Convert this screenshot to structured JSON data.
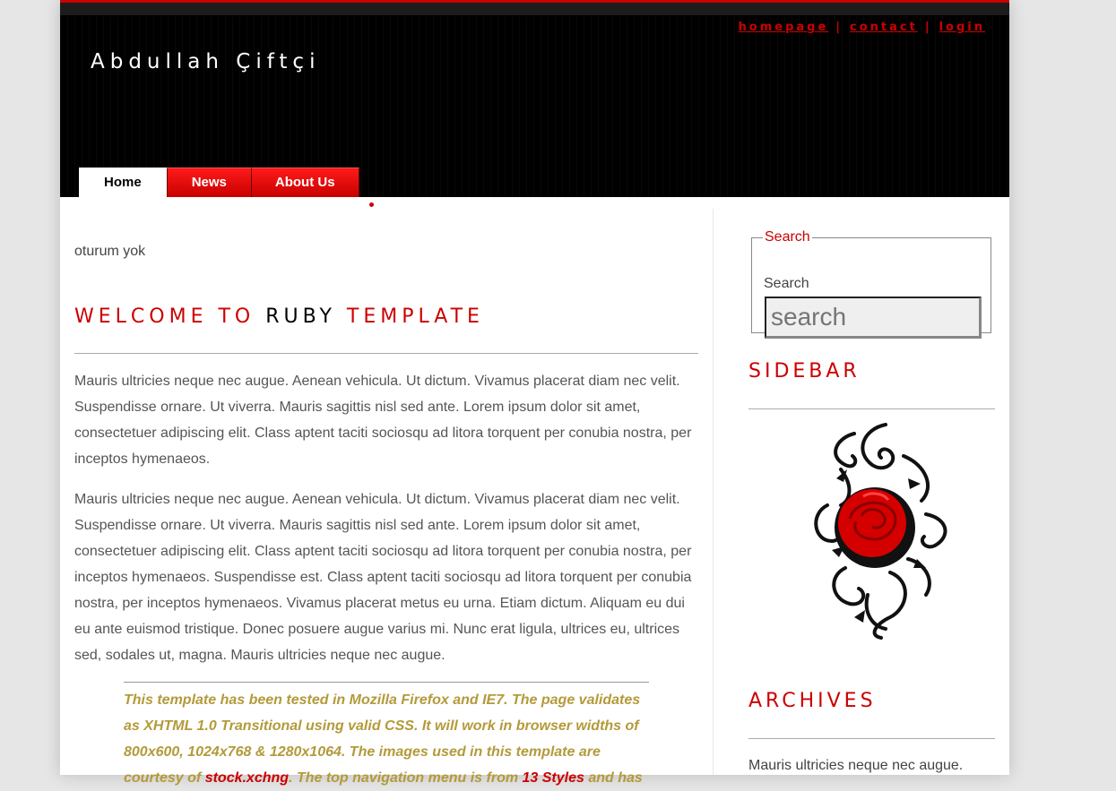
{
  "header": {
    "site_title": "Abdullah Çiftçi",
    "links": {
      "homepage": "homepage",
      "contact": "contact",
      "login": "login",
      "separator": "|"
    }
  },
  "nav": {
    "tabs": [
      {
        "label": "Home"
      },
      {
        "label": "News"
      },
      {
        "label": "About Us"
      }
    ]
  },
  "main": {
    "status": "oturum yok",
    "heading": {
      "part1": "WELCOME TO ",
      "part2": "RUBY",
      "part3": " TEMPLATE"
    },
    "paragraph1": "Mauris ultricies neque nec augue. Aenean vehicula. Ut dictum. Vivamus placerat diam nec velit. Suspendisse ornare. Ut viverra. Mauris sagittis nisl sed ante. Lorem ipsum dolor sit amet, consectetuer adipiscing elit. Class aptent taciti sociosqu ad litora torquent per conubia nostra, per inceptos hymenaeos.",
    "paragraph2": "Mauris ultricies neque nec augue. Aenean vehicula. Ut dictum. Vivamus placerat diam nec velit. Suspendisse ornare. Ut viverra. Mauris sagittis nisl sed ante. Lorem ipsum dolor sit amet, consectetuer adipiscing elit. Class aptent taciti sociosqu ad litora torquent per conubia nostra, per inceptos hymenaeos. Suspendisse est. Class aptent taciti sociosqu ad litora torquent per conubia nostra, per inceptos hymenaeos. Vivamus placerat metus eu urna. Etiam dictum. Aliquam eu dui eu ante euismod tristique. Donec posuere augue varius mi. Nunc erat ligula, ultrices eu, ultrices sed, sodales ut, magna. Mauris ultricies neque nec augue.",
    "quote": {
      "text1": "This template has been tested in Mozilla Firefox and IE7. The page validates as XHTML 1.0 Transitional using valid CSS. It will work in browser widths of 800x600, 1024x768 & 1280x1064. The images used in this template are courtesy of ",
      "link1": "stock.xchng",
      "text2": ". The top navigation menu is from ",
      "link2": "13 Styles",
      "text3": " and has"
    }
  },
  "sidebar": {
    "search": {
      "legend": "Search",
      "label": "Search",
      "placeholder": "search"
    },
    "heading1": "SIDEBAR",
    "heading2": "ARCHIVES",
    "text": "Mauris ultricies neque nec augue."
  },
  "colors": {
    "accent": "#cc0000",
    "header_bg": "#000000",
    "quote": "#b39a3a",
    "page_bg": "#e6e6e6"
  }
}
